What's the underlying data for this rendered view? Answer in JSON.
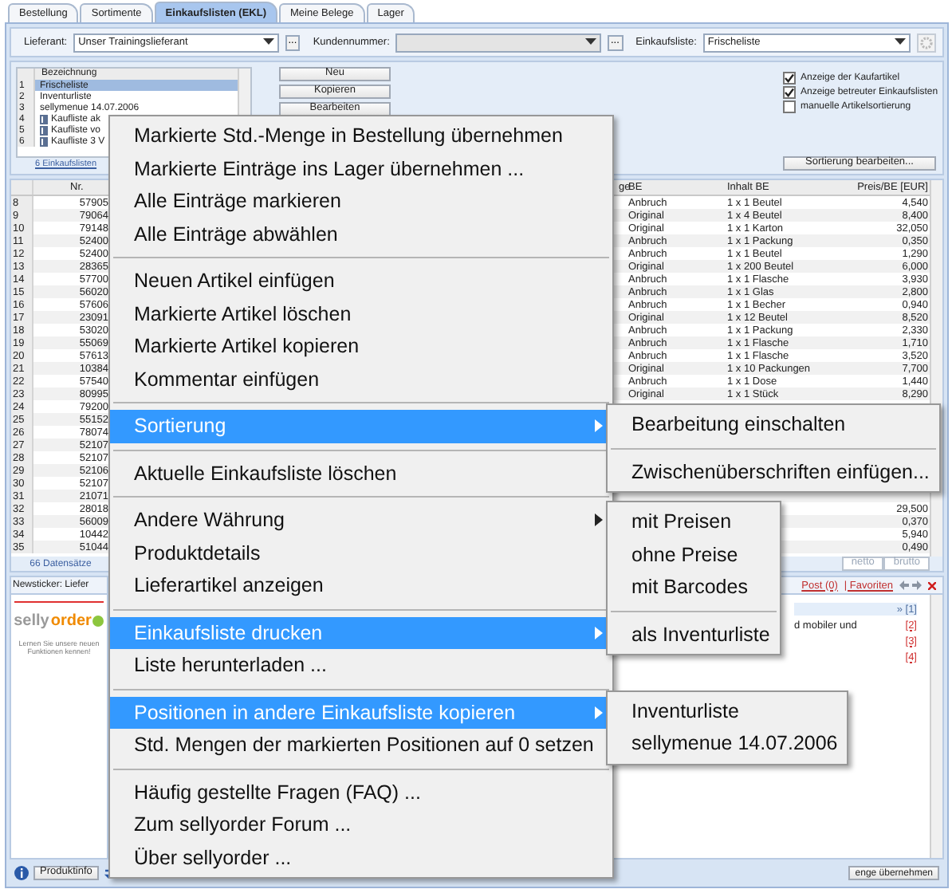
{
  "tabs": [
    {
      "label": "Bestellung",
      "selected": false
    },
    {
      "label": "Sortimente",
      "selected": false
    },
    {
      "label": "Einkaufslisten (EKL)",
      "selected": true
    },
    {
      "label": "Meine Belege",
      "selected": false
    },
    {
      "label": "Lager",
      "selected": false
    }
  ],
  "toolbar": {
    "fields": [
      {
        "label": "Lieferant:",
        "value": "Unser Trainingslieferant",
        "disabled": false,
        "browse": "..."
      },
      {
        "label": "Kundennummer:",
        "disabled": true,
        "browse": "..."
      },
      {
        "label": "Einkaufsliste:",
        "value": "Frischeliste",
        "disabled": false
      }
    ]
  },
  "lists": {
    "header": "Bezeichnung",
    "rows": [
      {
        "num": "1",
        "name": "Frischeliste",
        "kind": "own",
        "selected": true
      },
      {
        "num": "2",
        "name": "Inventurliste",
        "kind": "own",
        "selected": false
      },
      {
        "num": "3",
        "name": "sellymenue 14.07.2006",
        "kind": "own",
        "selected": false
      },
      {
        "num": "4",
        "name": "Kaufliste ak",
        "kind": "shared",
        "selected": false
      },
      {
        "num": "5",
        "name": "Kaufliste vo",
        "kind": "shared",
        "selected": false
      },
      {
        "num": "6",
        "name": "Kaufliste 3 V",
        "kind": "shared",
        "selected": false
      }
    ],
    "footer": "6 Einkaufslisten"
  },
  "list_buttons": [
    "Neu",
    "Kopieren",
    "Bearbeiten"
  ],
  "options": [
    {
      "label": "Anzeige der Kaufartikel",
      "checked": true
    },
    {
      "label": "Anzeige betreuter Einkaufslisten",
      "checked": true
    },
    {
      "label": "manuelle Artikelsortierung",
      "checked": false
    }
  ],
  "sort_button": "Sortierung bearbeiten...",
  "table": {
    "columns": {
      "nr": "Nr.",
      "column_4": "ge",
      "be": "BE",
      "inhalt": "Inhalt BE",
      "price": "Preis/BE [EUR]"
    },
    "rows": [
      {
        "num": "8",
        "nr": "57905",
        "be": "Anbruch",
        "inhalt": "1 x 1 Beutel",
        "price": "4,540"
      },
      {
        "num": "9",
        "nr": "79064",
        "be": "Original",
        "inhalt": "1 x 4 Beutel",
        "price": "8,400"
      },
      {
        "num": "10",
        "nr": "79148",
        "be": "Original",
        "inhalt": "1 x 1 Karton",
        "price": "32,050"
      },
      {
        "num": "11",
        "nr": "52400",
        "be": "Anbruch",
        "inhalt": "1 x 1 Packung",
        "price": "0,350"
      },
      {
        "num": "12",
        "nr": "52400",
        "be": "Anbruch",
        "inhalt": "1 x 1 Beutel",
        "price": "1,290"
      },
      {
        "num": "13",
        "nr": "28365",
        "be": "Original",
        "inhalt": "1 x 200 Beutel",
        "price": "6,000"
      },
      {
        "num": "14",
        "nr": "57700",
        "be": "Anbruch",
        "inhalt": "1 x 1 Flasche",
        "price": "3,930"
      },
      {
        "num": "15",
        "nr": "56020",
        "be": "Anbruch",
        "inhalt": "1 x 1 Glas",
        "price": "2,800"
      },
      {
        "num": "16",
        "nr": "57606",
        "be": "Anbruch",
        "inhalt": "1 x 1 Becher",
        "price": "0,940"
      },
      {
        "num": "17",
        "nr": "23091",
        "be": "Original",
        "inhalt": "1 x 12 Beutel",
        "price": "8,520"
      },
      {
        "num": "18",
        "nr": "53020",
        "be": "Anbruch",
        "inhalt": "1 x 1 Packung",
        "price": "2,330"
      },
      {
        "num": "19",
        "nr": "55069",
        "be": "Anbruch",
        "inhalt": "1 x 1 Flasche",
        "price": "1,710"
      },
      {
        "num": "20",
        "nr": "57613",
        "be": "Anbruch",
        "inhalt": "1 x 1 Flasche",
        "price": "3,520"
      },
      {
        "num": "21",
        "nr": "10384",
        "be": "Original",
        "inhalt": "1 x 10 Packungen",
        "price": "7,700"
      },
      {
        "num": "22",
        "nr": "57540",
        "be": "Anbruch",
        "inhalt": "1 x 1 Dose",
        "price": "1,440"
      },
      {
        "num": "23",
        "nr": "80995",
        "be": "Original",
        "inhalt": "1 x 1 Stück",
        "price": "8,290"
      },
      {
        "num": "24",
        "nr": "79200"
      },
      {
        "num": "25",
        "nr": "55152"
      },
      {
        "num": "26",
        "nr": "78074"
      },
      {
        "num": "27",
        "nr": "52107"
      },
      {
        "num": "28",
        "nr": "52107"
      },
      {
        "num": "29",
        "nr": "52106"
      },
      {
        "num": "30",
        "nr": "52107"
      },
      {
        "num": "31",
        "nr": "21071"
      },
      {
        "num": "32",
        "nr": "28018",
        "price": "29,500"
      },
      {
        "num": "33",
        "nr": "56009",
        "price": "0,370"
      },
      {
        "num": "34",
        "nr": "10442",
        "price": "5,940"
      },
      {
        "num": "35",
        "nr": "51044",
        "price": "0,490"
      }
    ],
    "footer": "66 Datensätze",
    "price_modes": [
      {
        "label": "netto",
        "selected": false
      },
      {
        "label": "brutto",
        "selected": false
      }
    ]
  },
  "newsticker": {
    "title": "Newsticker: Liefer",
    "logo": [
      "selly",
      "order"
    ],
    "caption": "Lernen Sie unsere neuen Funktionen kennen!"
  },
  "news": {
    "links": [
      "Post (0)",
      "| Favoriten"
    ],
    "items": [
      {
        "ref": "» [1]",
        "selected": true
      },
      {
        "text": "d mobiler und",
        "ref": "[2]",
        "selected": false
      },
      {
        "ref": "[3]",
        "selected": false
      },
      {
        "ref": "[4]",
        "selected": false
      }
    ]
  },
  "bottom": {
    "produktinfo": "Produktinfo",
    "apply": "enge übernehmen"
  },
  "menu": [
    {
      "kind": "item",
      "label": "Markierte Std.-Menge in Bestellung übernehmen",
      "selected": false
    },
    {
      "kind": "item",
      "label": "Markierte Einträge ins Lager übernehmen ...",
      "selected": false
    },
    {
      "kind": "item",
      "label": "Alle Einträge markieren",
      "selected": false
    },
    {
      "kind": "item",
      "label": "Alle Einträge abwählen",
      "selected": false
    },
    {
      "kind": "separator"
    },
    {
      "kind": "item",
      "label": "Neuen Artikel einfügen",
      "selected": false
    },
    {
      "kind": "item",
      "label": "Markierte Artikel löschen",
      "selected": false
    },
    {
      "kind": "item",
      "label": "Markierte Artikel kopieren",
      "selected": false
    },
    {
      "kind": "item",
      "label": "Kommentar einfügen",
      "selected": false
    },
    {
      "kind": "separator"
    },
    {
      "kind": "item",
      "label": "Sortierung",
      "selected": true,
      "arrow": true,
      "opens_up": false,
      "submenu": [
        {
          "kind": "item",
          "label": "Bearbeitung einschalten"
        },
        {
          "kind": "separator"
        },
        {
          "kind": "item",
          "label": "Zwischenüberschriften einfügen..."
        }
      ]
    },
    {
      "kind": "separator"
    },
    {
      "kind": "item",
      "label": "Aktuelle Einkaufsliste löschen",
      "selected": false
    },
    {
      "kind": "separator"
    },
    {
      "kind": "item",
      "label": "Andere Währung",
      "selected": false,
      "arrow": true
    },
    {
      "kind": "item",
      "label": "Produktdetails",
      "selected": false
    },
    {
      "kind": "item",
      "label": "Lieferartikel anzeigen",
      "selected": false
    },
    {
      "kind": "separator"
    },
    {
      "kind": "item",
      "label": "Einkaufsliste drucken",
      "selected": true,
      "arrow": true,
      "opens_up": true,
      "submenu": [
        {
          "kind": "item",
          "label": "mit Preisen"
        },
        {
          "kind": "item",
          "label": "ohne Preise"
        },
        {
          "kind": "item",
          "label": "mit Barcodes"
        },
        {
          "kind": "separator"
        },
        {
          "kind": "item",
          "label": "als Inventurliste"
        }
      ]
    },
    {
      "kind": "item",
      "label": "Liste herunterladen ...",
      "selected": false
    },
    {
      "kind": "separator"
    },
    {
      "kind": "item",
      "label": "Positionen in andere Einkaufsliste kopieren",
      "selected": true,
      "arrow": true,
      "opens_up": false,
      "submenu": [
        {
          "kind": "item",
          "label": "Inventurliste"
        },
        {
          "kind": "item",
          "label": "sellymenue 14.07.2006"
        }
      ]
    },
    {
      "kind": "item",
      "label": "Std. Mengen der markierten Positionen auf 0 setzen",
      "selected": false
    },
    {
      "kind": "separator"
    },
    {
      "kind": "item",
      "label": "Häufig gestellte Fragen (FAQ) ...",
      "selected": false
    },
    {
      "kind": "item",
      "label": "Zum sellyorder Forum ...",
      "selected": false
    },
    {
      "kind": "item",
      "label": "Über sellyorder ...",
      "selected": false
    }
  ]
}
